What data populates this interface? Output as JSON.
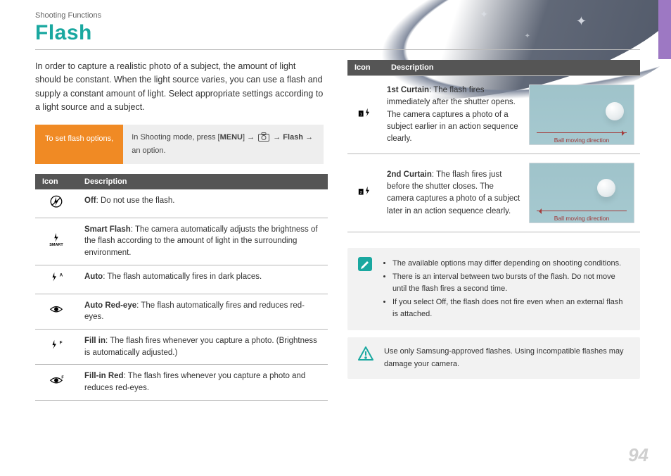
{
  "crumb": "Shooting Functions",
  "title": "Flash",
  "intro": "In order to capture a realistic photo of a subject, the amount of light should be constant. When the light source varies, you can use a flash and supply a constant amount of light. Select appropriate settings according to a light source and a subject.",
  "callout": {
    "left": "To set flash options,",
    "right_prefix": "In Shooting mode, press [",
    "right_menu": "MENU",
    "right_mid": "] →",
    "right_cam_label": "camera-icon",
    "right_flash": "Flash",
    "right_suffix": "→ an option."
  },
  "table": {
    "head_icon": "Icon",
    "head_desc": "Description",
    "rows": [
      {
        "icon_name": "flash-off-icon",
        "title": "Off",
        "text": ": Do not use the flash."
      },
      {
        "icon_name": "flash-smart-icon",
        "title": "Smart Flash",
        "text": ": The camera automatically adjusts the brightness of the flash according to the amount of light in the surrounding environment."
      },
      {
        "icon_name": "flash-auto-icon",
        "title": "Auto",
        "text": ": The flash automatically fires in dark places."
      },
      {
        "icon_name": "flash-auto-redeye-icon",
        "title": "Auto Red-eye",
        "text": ": The flash automatically fires and reduces red-eyes."
      },
      {
        "icon_name": "flash-fillin-icon",
        "title": "Fill in",
        "text": ": The flash fires whenever you capture a photo. (Brightness is automatically adjusted.)"
      },
      {
        "icon_name": "flash-fillin-red-icon",
        "title": "Fill-in Red",
        "text": ": The flash fires whenever you capture a photo and reduces red-eyes."
      }
    ]
  },
  "curtain": {
    "head_icon": "Icon",
    "head_desc": "Description",
    "rows": [
      {
        "icon_name": "first-curtain-icon",
        "title": "1st Curtain",
        "text": ": The flash fires immediately after the shutter opens. The camera captures a photo of a subject earlier in an action sequence clearly.",
        "caption": "Ball moving direction",
        "thumb": "t1"
      },
      {
        "icon_name": "second-curtain-icon",
        "title": "2nd Curtain",
        "text": ": The flash fires just before the shutter closes. The camera captures a photo of a subject later in an action sequence clearly.",
        "caption": "Ball moving direction",
        "thumb": "t2"
      }
    ]
  },
  "info": {
    "icon_name": "pencil-note-icon",
    "items": [
      "The available options may differ depending on shooting conditions.",
      "There is an interval between two bursts of the flash. Do not move until the flash fires a second time.",
      "If you select Off, the flash does not fire even when an external flash is attached."
    ]
  },
  "warning": {
    "icon_name": "warning-icon",
    "text": "Use only Samsung-approved flashes. Using incompatible flashes may damage your camera."
  },
  "page_number": "94"
}
